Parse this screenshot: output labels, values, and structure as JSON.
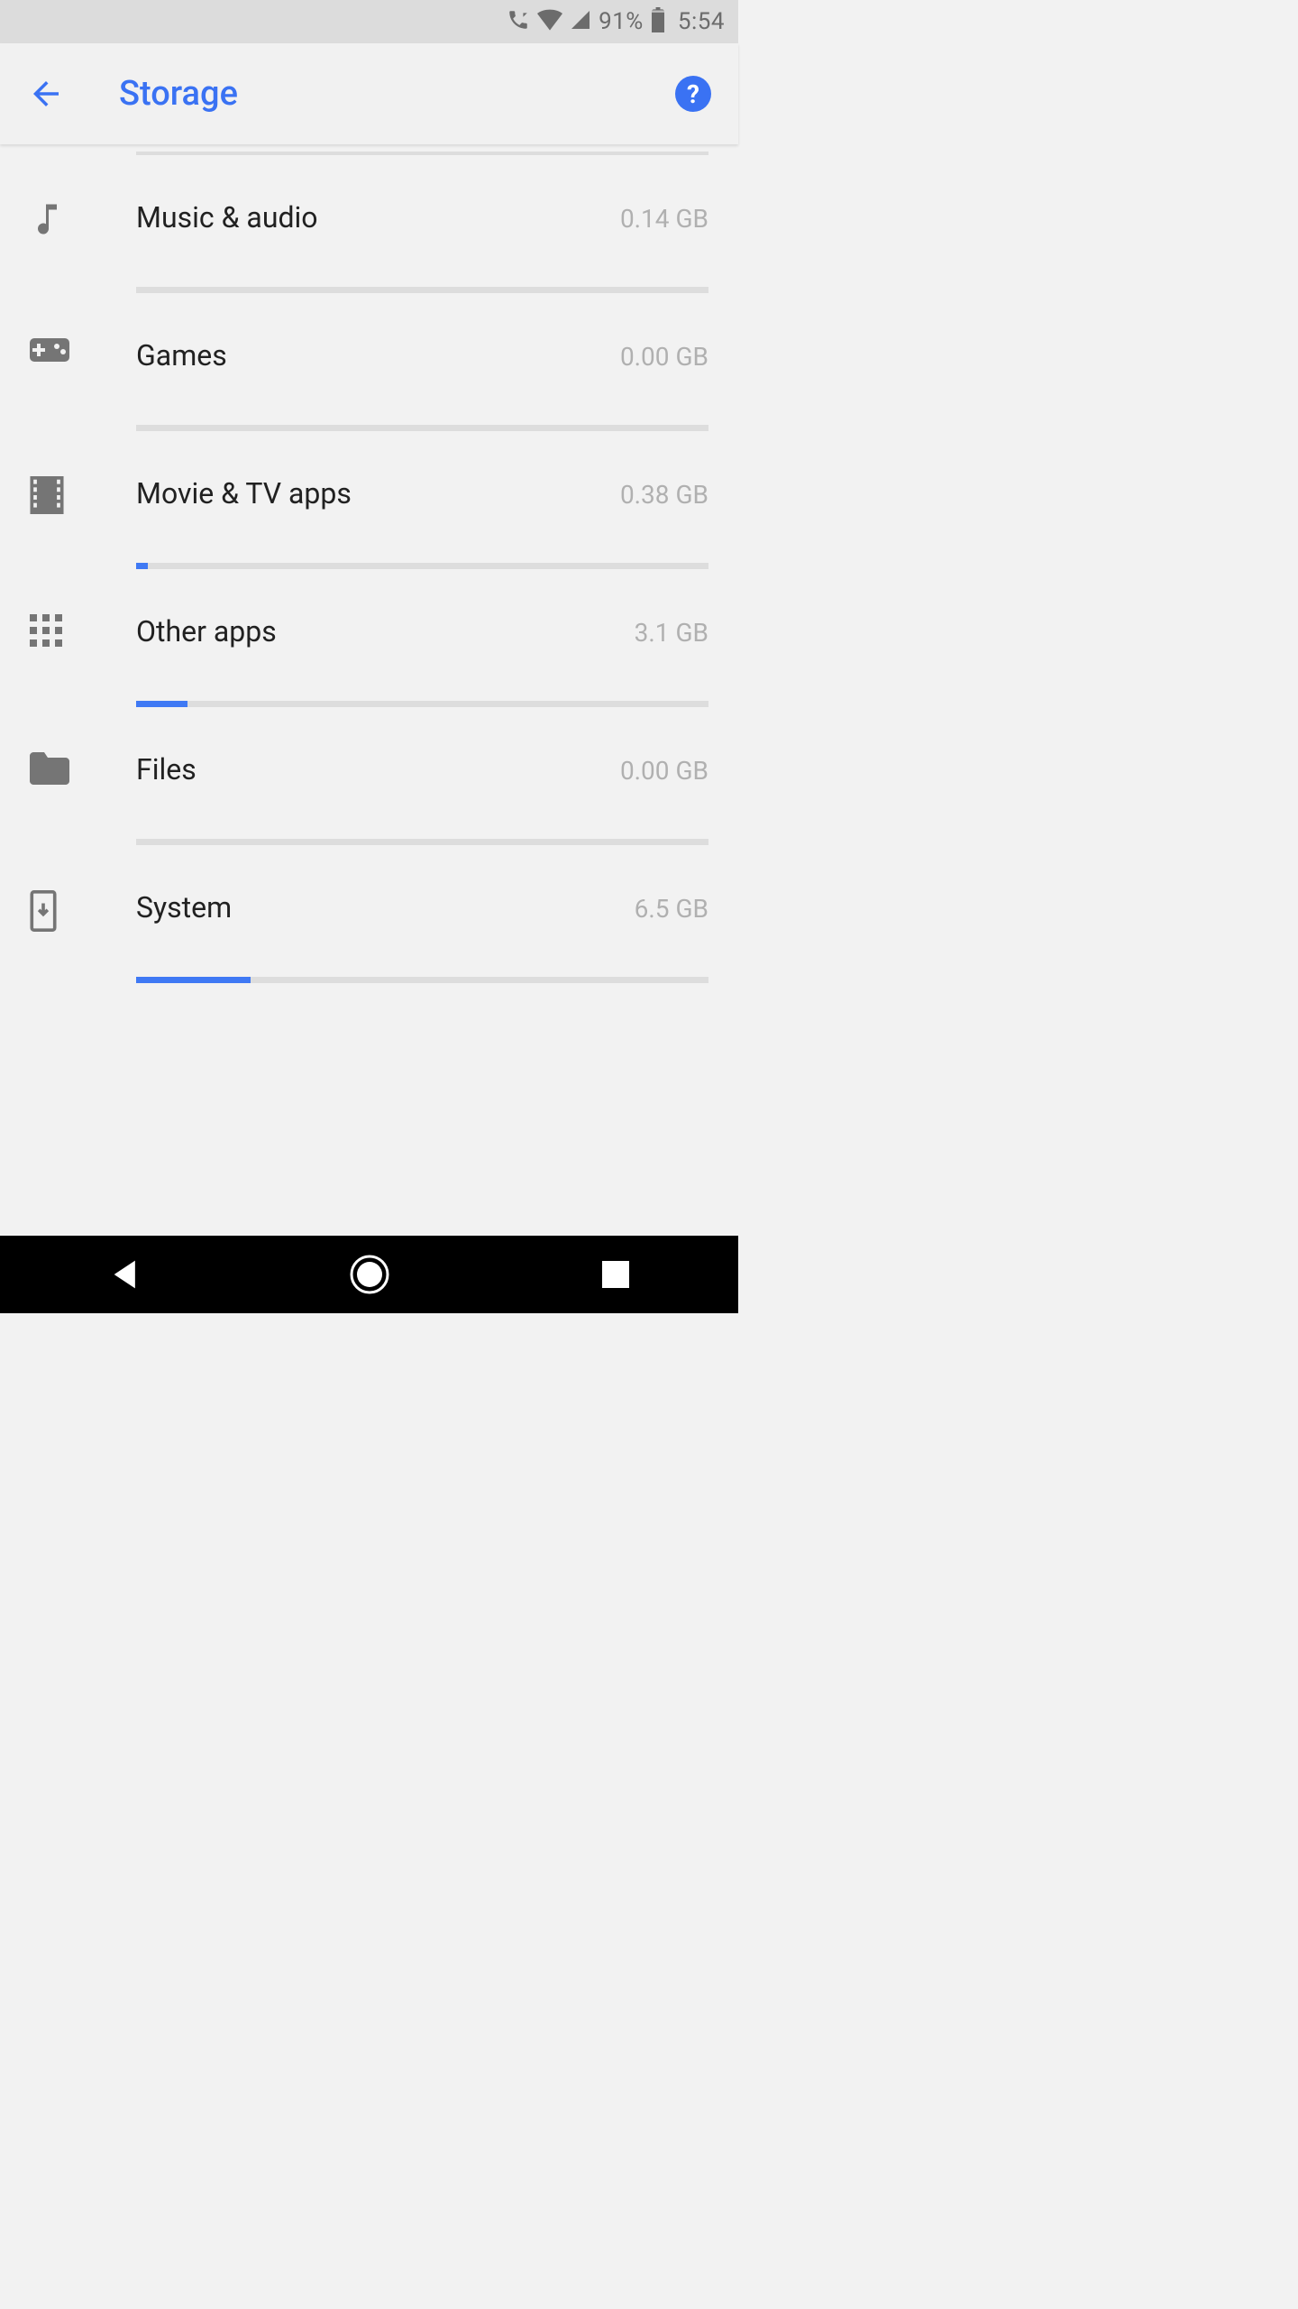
{
  "statusBar": {
    "battery": "91%",
    "time": "5:54"
  },
  "appBar": {
    "title": "Storage",
    "helpLabel": "?"
  },
  "categories": [
    {
      "icon": "music",
      "label": "Music & audio",
      "value": "0.14 GB",
      "percent": 0
    },
    {
      "icon": "game",
      "label": "Games",
      "value": "0.00 GB",
      "percent": 0
    },
    {
      "icon": "movie",
      "label": "Movie & TV apps",
      "value": "0.38 GB",
      "percent": 2
    },
    {
      "icon": "apps",
      "label": "Other apps",
      "value": "3.1 GB",
      "percent": 9
    },
    {
      "icon": "folder",
      "label": "Files",
      "value": "0.00 GB",
      "percent": 0
    },
    {
      "icon": "system",
      "label": "System",
      "value": "6.5 GB",
      "percent": 20
    }
  ]
}
